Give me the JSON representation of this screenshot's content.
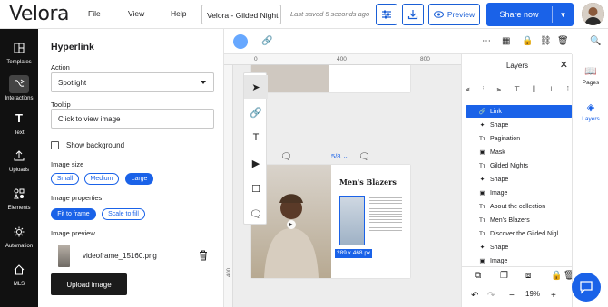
{
  "header": {
    "logo": "Velora",
    "menu": [
      "File",
      "View",
      "Help"
    ],
    "doc_name": "Velora - Gilded Night...",
    "saved": "Last saved 5 seconds ago",
    "preview": "Preview",
    "share": "Share now"
  },
  "leftnav": [
    {
      "label": "Templates",
      "icon": "templates-icon"
    },
    {
      "label": "Interactions",
      "icon": "interactions-icon"
    },
    {
      "label": "Text",
      "icon": "text-icon"
    },
    {
      "label": "Uploads",
      "icon": "upload-icon"
    },
    {
      "label": "Elements",
      "icon": "elements-icon"
    },
    {
      "label": "Automation",
      "icon": "automation-icon"
    },
    {
      "label": "MLS",
      "icon": "mls-icon"
    }
  ],
  "panel": {
    "title": "Hyperlink",
    "action_label": "Action",
    "action_value": "Spotlight",
    "tooltip_label": "Tooltip",
    "tooltip_value": "Click to view image",
    "show_background": "Show background",
    "image_size_label": "Image size",
    "sizes": [
      "Small",
      "Medium",
      "Large"
    ],
    "selected_size": "Large",
    "image_properties_label": "Image properties",
    "properties": [
      "Fit to frame",
      "Scale to fill"
    ],
    "selected_property": "Fit to frame",
    "image_preview_label": "Image preview",
    "file_name": "videoframe_15160.png",
    "upload_button": "Upload image"
  },
  "canvas": {
    "ruler": [
      "0",
      "400",
      "800"
    ],
    "ruler_v": "400",
    "page_indicator": "5/8",
    "page_heading": "Men's Blazers",
    "size_badge": "289 x 468 px"
  },
  "layers": {
    "title": "Layers",
    "items": [
      {
        "icon": "link",
        "label": "Link",
        "selected": true
      },
      {
        "icon": "shape",
        "label": "Shape"
      },
      {
        "icon": "text",
        "label": "Pagination"
      },
      {
        "icon": "image",
        "label": "Mask"
      },
      {
        "icon": "text",
        "label": "Gilded Nights"
      },
      {
        "icon": "shape",
        "label": "Shape"
      },
      {
        "icon": "image",
        "label": "Image"
      },
      {
        "icon": "text",
        "label": "About the collection"
      },
      {
        "icon": "text",
        "label": "Men's Blazers"
      },
      {
        "icon": "text",
        "label": "Discover the Gilded Nigl"
      },
      {
        "icon": "shape",
        "label": "Shape"
      },
      {
        "icon": "image",
        "label": "Image"
      }
    ],
    "zoom": "19%"
  },
  "rightnav": [
    {
      "label": "Pages",
      "icon": "pages-icon"
    },
    {
      "label": "Layers",
      "icon": "layers-icon",
      "active": true
    }
  ],
  "colors": {
    "accent": "#1a62e8",
    "nav": "#111111"
  }
}
